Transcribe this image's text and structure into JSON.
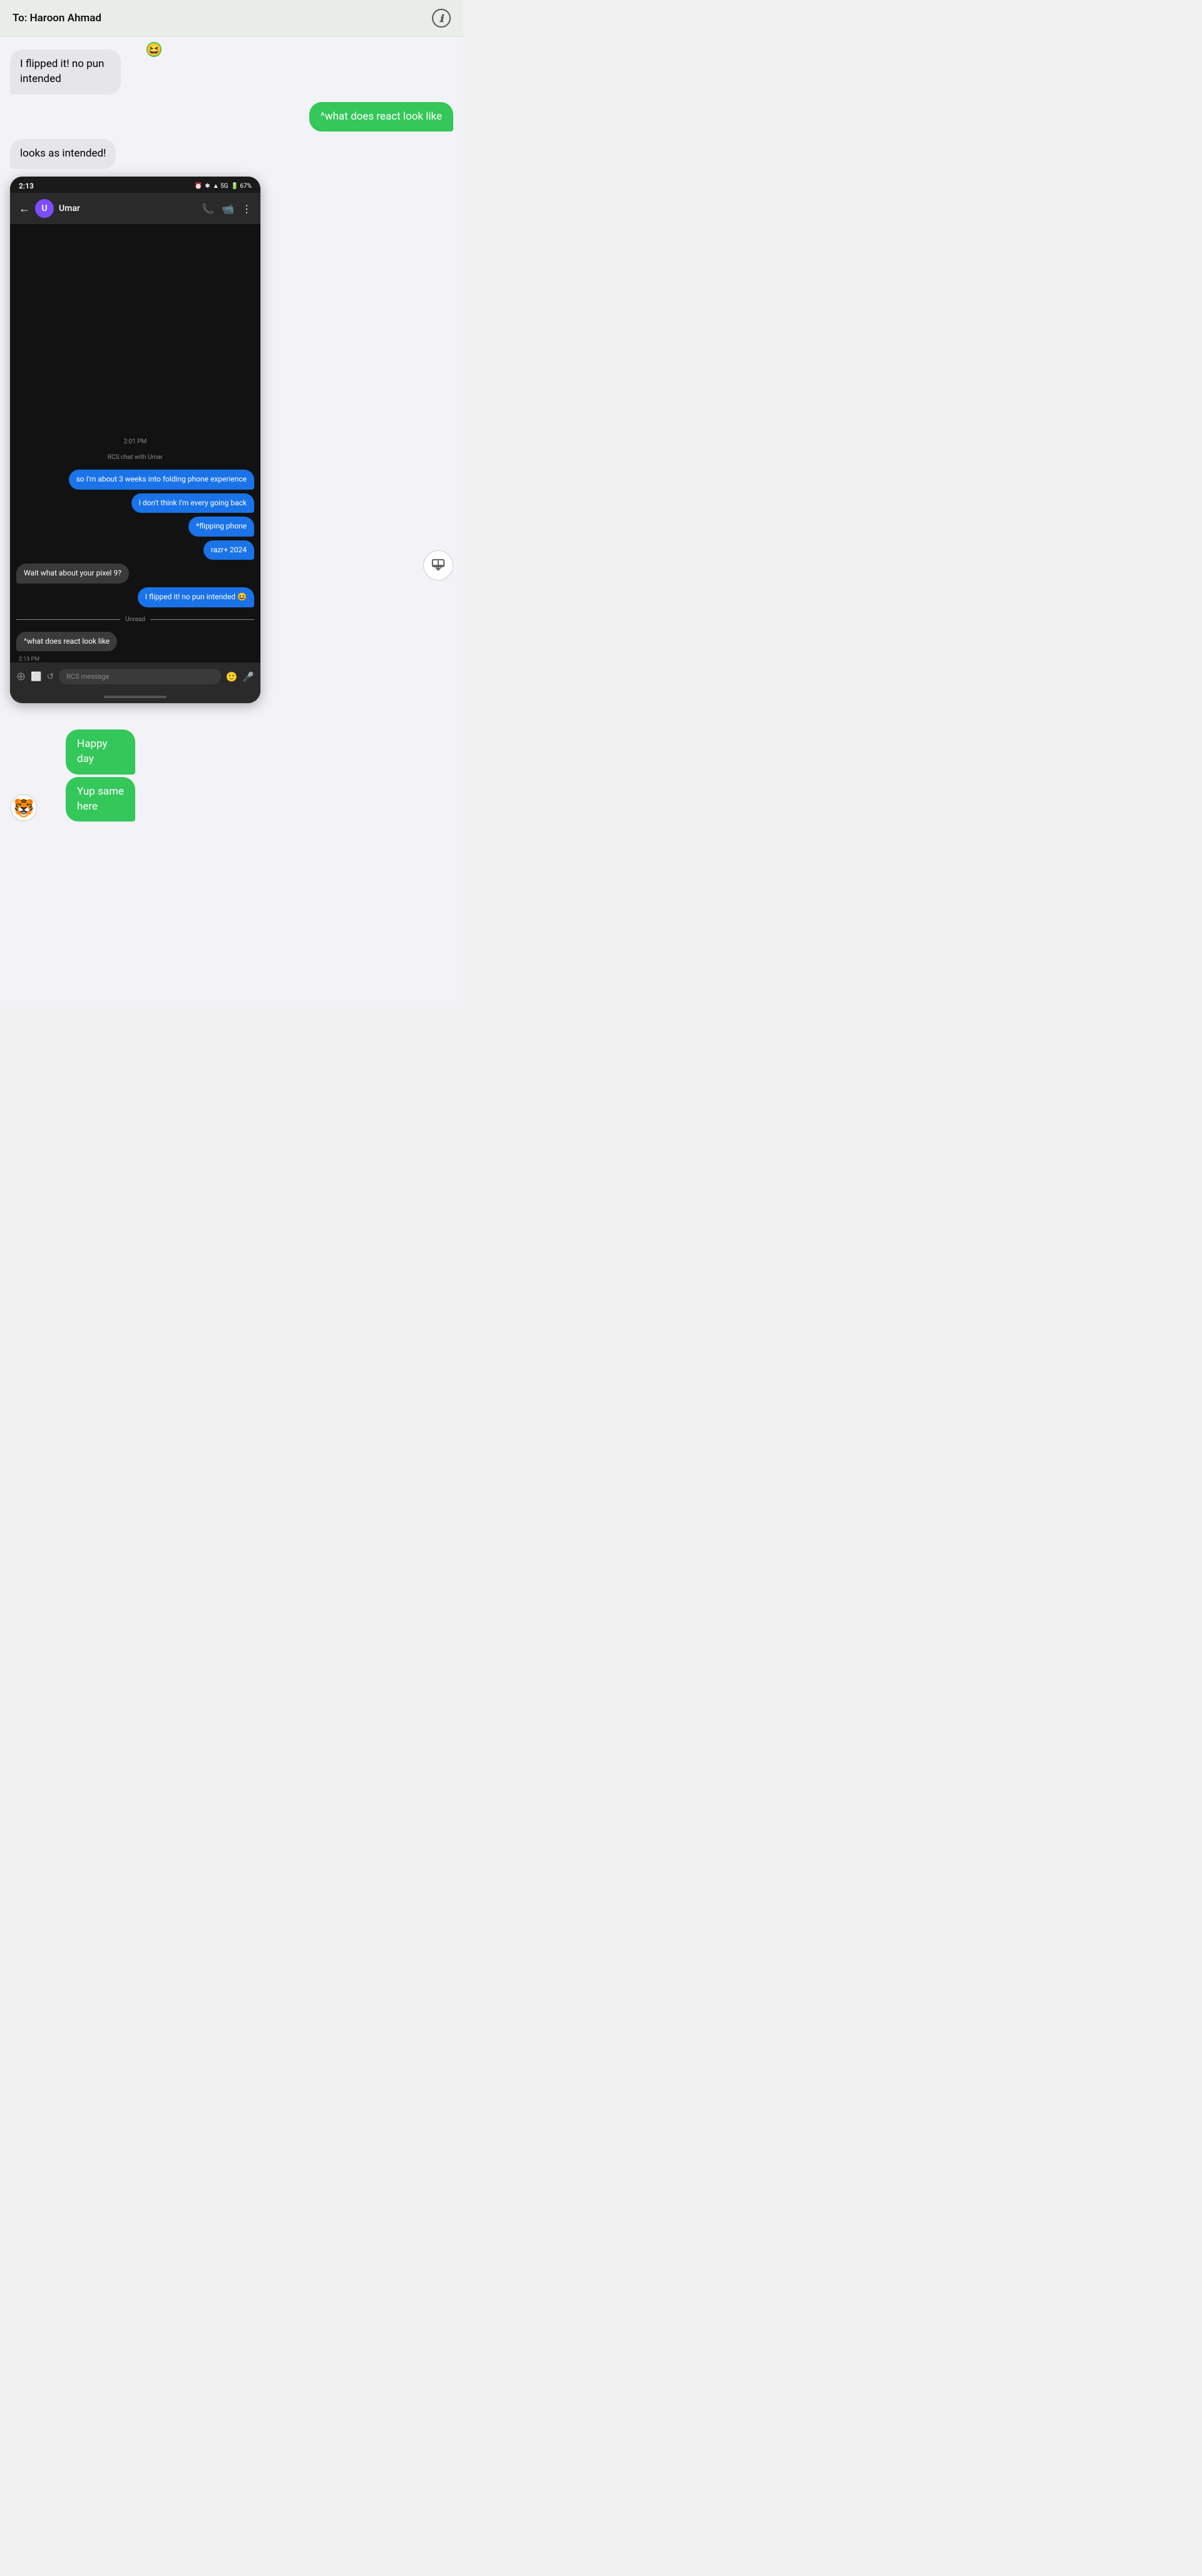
{
  "header": {
    "to_label": "To:",
    "contact_name": "Haroon Ahmad",
    "info_icon": "ℹ"
  },
  "messages": [
    {
      "id": "msg1",
      "type": "received",
      "text": "I flipped it! no pun intended",
      "has_reaction": true,
      "reaction_emoji": "😆"
    },
    {
      "id": "msg2",
      "type": "sent",
      "text": "^what does react look like"
    },
    {
      "id": "msg3",
      "type": "received",
      "text": "looks as intended!"
    }
  ],
  "screenshot": {
    "status_time": "2:13",
    "status_icons": "⏰ ✱ 📶 5G 🔋67%",
    "contact_initial": "U",
    "contact_name": "Umar",
    "time_label": "2:01 PM",
    "rcs_label": "RCS chat with Umar",
    "inner_messages": [
      {
        "type": "sent",
        "text": "so I'm about 3 weeks into folding phone experience"
      },
      {
        "type": "sent",
        "text": "I don't think I'm every going back"
      },
      {
        "type": "sent",
        "text": "*flipping phone"
      },
      {
        "type": "sent",
        "text": "razr+ 2024"
      },
      {
        "type": "received",
        "text": "Wait what about your pixel 9?"
      },
      {
        "type": "sent",
        "text": "I flipped it! no pun intended",
        "emoji_suffix": "😆"
      }
    ],
    "unread_label": "Unread",
    "unread_message": "^what does react look like",
    "unread_time": "2:13 PM",
    "input_placeholder": "RCS message"
  },
  "bottom_messages": [
    {
      "id": "bottom1",
      "type": "sent",
      "text": "Happy day",
      "has_tiger": true
    },
    {
      "id": "bottom2",
      "type": "sent",
      "text": "Yup same here"
    }
  ]
}
